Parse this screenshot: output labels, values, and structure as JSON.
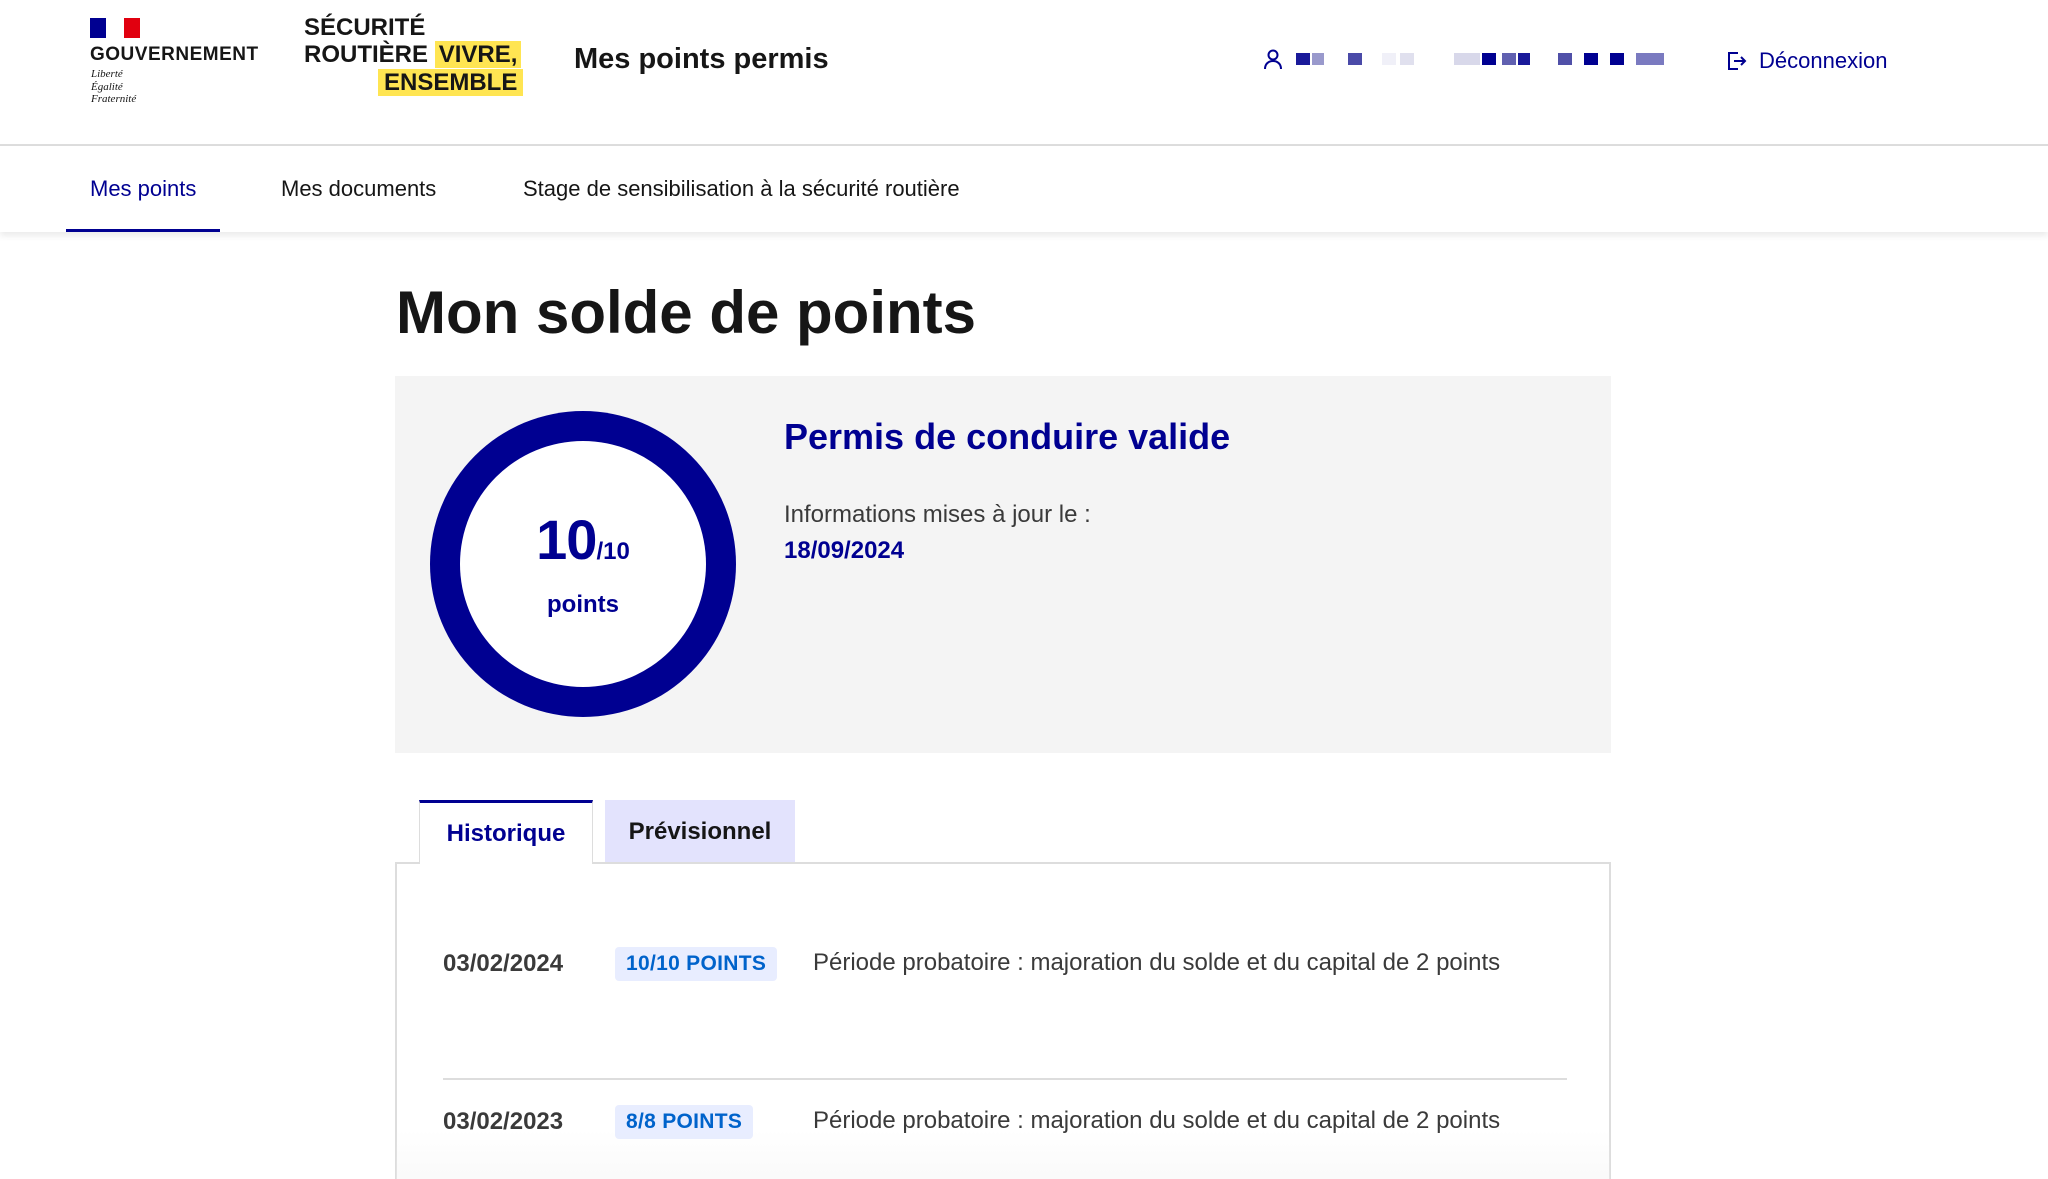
{
  "header": {
    "gov_title": "GOUVERNEMENT",
    "gov_motto": [
      "Liberté",
      "Égalité",
      "Fraternité"
    ],
    "sr_logo": {
      "line1": "SÉCURITÉ",
      "line2_a": "ROUTIÈRE ",
      "line2_b": "VIVRE,",
      "line3": "ENSEMBLE"
    },
    "service_title": "Mes points permis",
    "user_icon": "user-icon",
    "logout_icon": "logout-icon",
    "logout_label": "Déconnexion",
    "colors": {
      "flag_blue": "#000091",
      "flag_red": "#e1000f",
      "logo_highlight": "#ffe552"
    }
  },
  "nav": {
    "items": [
      {
        "label": "Mes points",
        "active": true
      },
      {
        "label": "Mes documents",
        "active": false
      },
      {
        "label": "Stage de sensibilisation à la sécurité routière",
        "active": false
      }
    ]
  },
  "main": {
    "title": "Mon solde de points",
    "card": {
      "score": "10",
      "score_max": "/10",
      "score_unit": "points",
      "score_fraction": 1.0,
      "status": "Permis de conduire valide",
      "updated_label": "Informations mises à jour le :",
      "updated_date": "18/09/2024",
      "accent_color": "#000091"
    },
    "tabs": [
      {
        "label": "Historique",
        "active": true
      },
      {
        "label": "Prévisionnel",
        "active": false
      }
    ],
    "history": [
      {
        "date": "03/02/2024",
        "badge": "10/10 POINTS",
        "description": "Période probatoire : majoration du solde et du capital de 2 points"
      },
      {
        "date": "03/02/2023",
        "badge": "8/8 POINTS",
        "description": "Période probatoire : majoration du solde et du capital de 2 points"
      }
    ]
  }
}
